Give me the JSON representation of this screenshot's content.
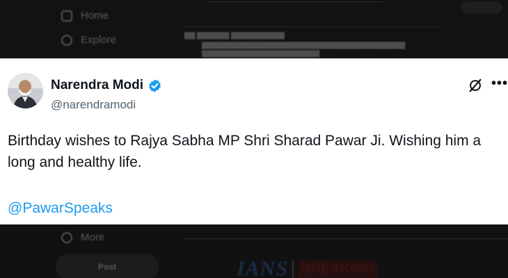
{
  "background": {
    "nav_items": [
      {
        "label": "Home",
        "icon": "home-icon"
      },
      {
        "label": "Explore",
        "icon": "search-icon"
      },
      {
        "label": "More",
        "icon": "more-circle-icon"
      }
    ],
    "post_button_label": "Post",
    "news_brand": "IANS",
    "news_badge": "BREAKING"
  },
  "tweet": {
    "author_name": "Narendra Modi",
    "author_handle": "@narendramodi",
    "verified": true,
    "text": "Birthday wishes to Rajya Sabha MP Shri Sharad Pawar Ji. Wishing him a long and healthy life.",
    "mention": "@PawarSpeaks",
    "icons": [
      "grok-icon",
      "more-icon"
    ]
  },
  "colors": {
    "verified_badge": "#1d9bf0",
    "mention_link": "#1d9bf0",
    "handle_gray": "#536471",
    "text": "#0f1419"
  }
}
